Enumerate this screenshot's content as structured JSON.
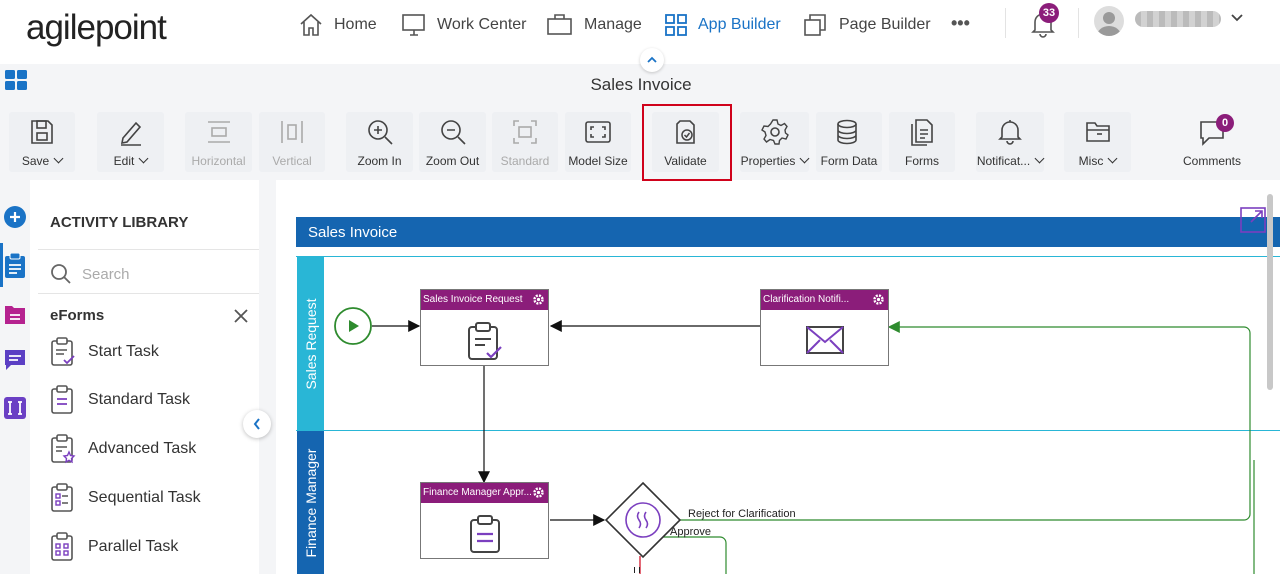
{
  "brand": {
    "logo_text": "agilepoint"
  },
  "nav": {
    "home": "Home",
    "work_center": "Work Center",
    "manage": "Manage",
    "app_builder": "App Builder",
    "page_builder": "Page Builder",
    "more": "•••",
    "notification_count": "33",
    "active_color": "#1a73c6"
  },
  "page": {
    "title": "Sales Invoice"
  },
  "toolbar": {
    "save": "Save",
    "edit": "Edit",
    "horizontal": "Horizontal",
    "vertical": "Vertical",
    "zoom_in": "Zoom In",
    "zoom_out": "Zoom Out",
    "standard": "Standard",
    "model_size": "Model Size",
    "validate": "Validate",
    "properties": "Properties",
    "form_data": "Form Data",
    "forms": "Forms",
    "notifications": "Notificat...",
    "misc": "Misc",
    "comments": "Comments",
    "comments_count": "0",
    "highlight_color": "#d0021b"
  },
  "library": {
    "title": "ACTIVITY LIBRARY",
    "search_placeholder": "Search",
    "group": "eForms",
    "items": [
      {
        "label": "Start Task",
        "icon": "start-task-icon"
      },
      {
        "label": "Standard Task",
        "icon": "standard-task-icon"
      },
      {
        "label": "Advanced Task",
        "icon": "advanced-task-icon"
      },
      {
        "label": "Sequential Task",
        "icon": "sequential-task-icon"
      },
      {
        "label": "Parallel Task",
        "icon": "parallel-task-icon"
      }
    ]
  },
  "diagram": {
    "pool_title": "Sales Invoice",
    "lanes": [
      "Sales Request",
      "Finance Manager"
    ],
    "tasks": {
      "sales_invoice_request": "Sales Invoice Request",
      "clarification_notification": "Clarification Notifi...",
      "finance_manager_approval": "Finance Manager Appr..."
    },
    "flows": {
      "reject": "Reject for Clarification",
      "approve": "Approve"
    },
    "colors": {
      "pool": "#1565b0",
      "lane1": "#29b6d6",
      "lane2": "#1565b0",
      "task_header": "#8b1d7a",
      "reject_line": "#2e8b2e"
    }
  }
}
